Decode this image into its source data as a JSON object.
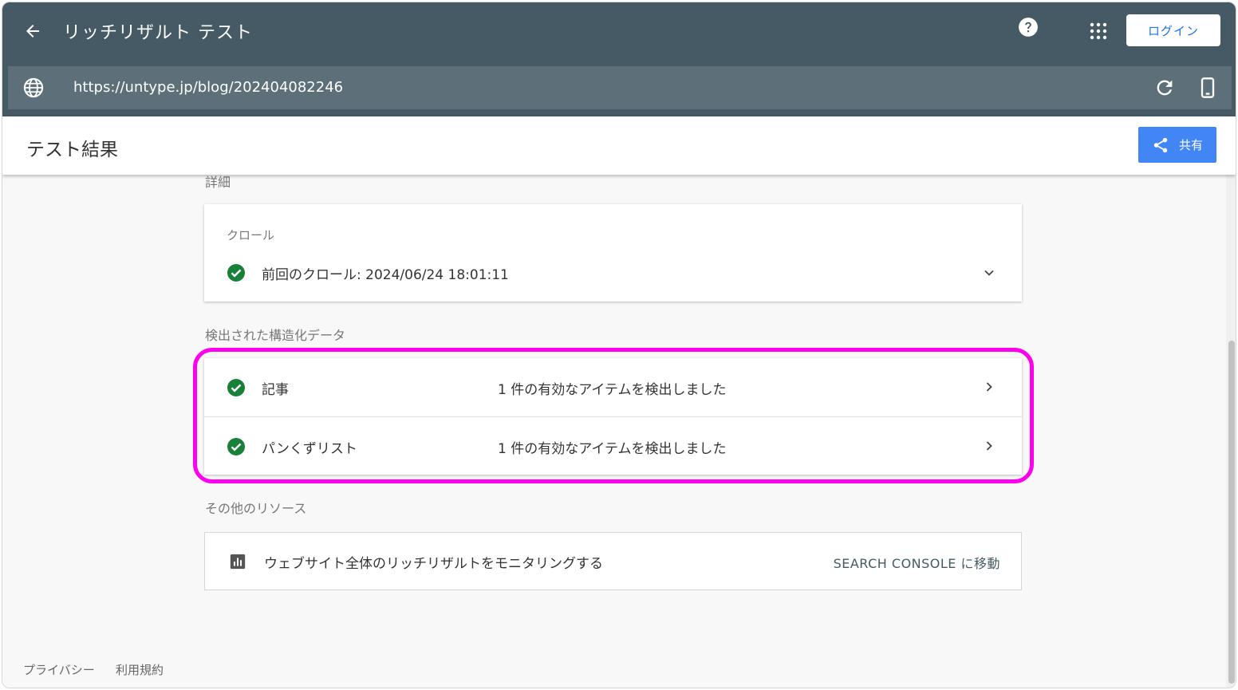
{
  "app": {
    "title": "リッチリザルト テスト",
    "login_label": "ログイン"
  },
  "urlbar": {
    "url": "https://untype.jp/blog/202404082246"
  },
  "header": {
    "title": "テスト結果",
    "share_label": "共有"
  },
  "details": {
    "label": "詳細",
    "crawl": {
      "title": "クロール",
      "status_text": "前回のクロール: 2024/06/24 18:01:11"
    }
  },
  "structured_data": {
    "label": "検出された構造化データ",
    "items": [
      {
        "name": "記事",
        "status": "1 件の有効なアイテムを検出しました"
      },
      {
        "name": "パンくずリスト",
        "status": "1 件の有効なアイテムを検出しました"
      }
    ]
  },
  "resources": {
    "label": "その他のリソース",
    "item_text": "ウェブサイト全体のリッチリザルトをモニタリングする",
    "link_label": "SEARCH CONSOLE に移動"
  },
  "footer": {
    "privacy": "プライバシー",
    "terms": "利用規約"
  },
  "colors": {
    "topbar": "#455a64",
    "urlbar": "#5d7079",
    "accent_blue": "#4285f4",
    "check_green": "#188038",
    "highlight": "#ff00ee"
  }
}
